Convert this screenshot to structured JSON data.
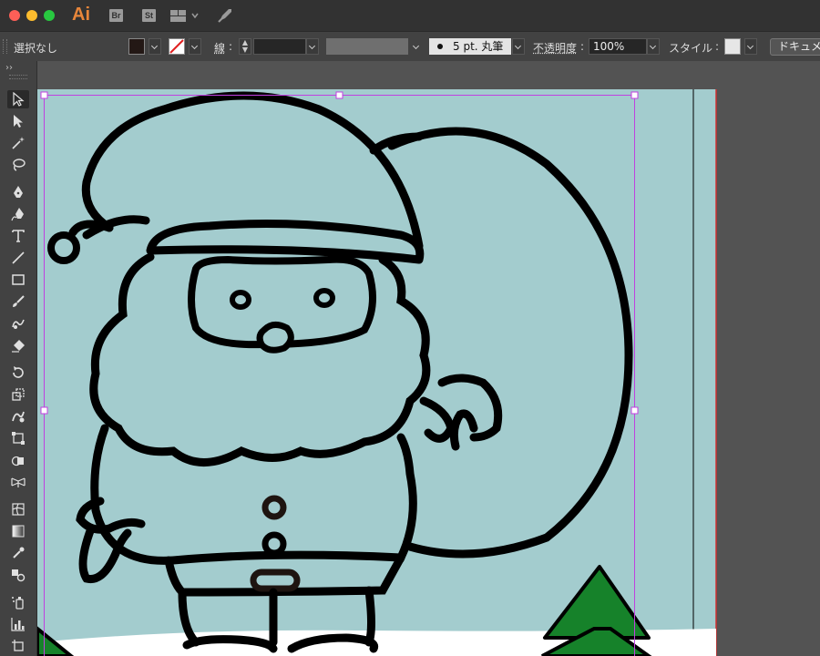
{
  "app": {
    "logo": "Ai",
    "bridge_label": "Br",
    "stock_label": "St",
    "workspace_icon": "workspace-grid-icon",
    "gpu_icon": "rocket-icon"
  },
  "control_bar": {
    "selection_status": "選択なし",
    "fill_color": "#231815",
    "stroke_label": "線",
    "stroke_weight": "",
    "brush_label": "5 pt. 丸筆",
    "opacity_label": "不透明度",
    "opacity_value": "100%",
    "style_label": "スタイル",
    "document_setup_label": "ドキュメント設定"
  },
  "toolbar": {
    "tools": [
      "selection-tool-icon",
      "direct-selection-tool-icon",
      "magic-wand-tool-icon",
      "lasso-tool-icon",
      "pen-tool-icon",
      "curvature-tool-icon",
      "type-tool-icon",
      "line-tool-icon",
      "rectangle-tool-icon",
      "paintbrush-tool-icon",
      "shaper-tool-icon",
      "eraser-tool-icon",
      "rotate-tool-icon",
      "scale-tool-icon",
      "warp-tool-icon",
      "free-transform-tool-icon",
      "shape-builder-tool-icon",
      "perspective-grid-tool-icon",
      "mesh-tool-icon",
      "gradient-tool-icon",
      "eyedropper-tool-icon",
      "blend-tool-icon",
      "symbol-sprayer-tool-icon",
      "column-graph-tool-icon",
      "artboard-tool-icon"
    ],
    "active_tool": "selection-tool-icon"
  },
  "canvas": {
    "background_color": "#a3ccce",
    "line_color": "#000000",
    "tree_color": "#16822a",
    "snow_color": "#ffffff",
    "selection_color": "#c040e0",
    "artboard_edge_color": "#d03030"
  }
}
